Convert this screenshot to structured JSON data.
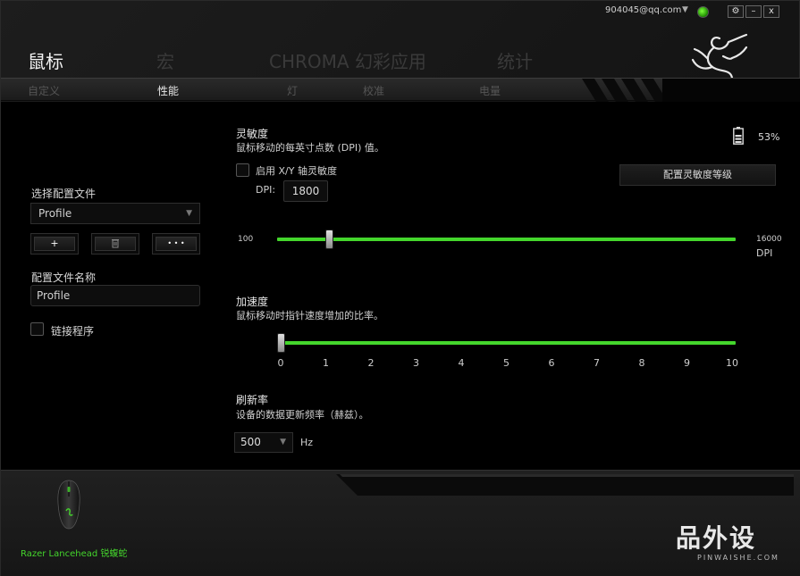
{
  "titlebar": {
    "account": "904045@qq.com",
    "gear_label": "⚙",
    "minimize_label": "–",
    "close_label": "x"
  },
  "main_tabs": [
    "鼠标",
    "宏",
    "CHROMA 幻彩应用",
    "统计"
  ],
  "sub_tabs": [
    "自定义",
    "性能",
    "灯",
    "校准",
    "电量"
  ],
  "left": {
    "select_profile_label": "选择配置文件",
    "profile_selected": "Profile",
    "add_label": "+",
    "delete_label": " ",
    "more_label": "• • •",
    "profile_name_label": "配置文件名称",
    "profile_name_value": "Profile",
    "link_program_label": "链接程序"
  },
  "sensitivity": {
    "title": "灵敏度",
    "description": "鼠标移动的每英寸点数 (DPI) 值。",
    "enable_xy_label": "启用 X/Y 轴灵敏度",
    "dpi_label": "DPI:",
    "dpi_value": "1800",
    "min_label": "100",
    "max_label": "16000",
    "unit_label": "DPI",
    "min": 100,
    "max": 16000,
    "value": 1800,
    "configure_button": "配置灵敏度等级"
  },
  "battery": {
    "percent": "53%"
  },
  "acceleration": {
    "title": "加速度",
    "description": "鼠标移动时指针速度增加的比率。",
    "ticks": [
      "0",
      "1",
      "2",
      "3",
      "4",
      "5",
      "6",
      "7",
      "8",
      "9",
      "10"
    ],
    "value": 0
  },
  "polling": {
    "title": "刷新率",
    "description": "设备的数据更新频率（赫兹）。",
    "selected": "500",
    "unit": "Hz"
  },
  "device": {
    "name": "Razer Lancehead 锐蝮蛇"
  },
  "watermark": {
    "title": "品外设",
    "url": "PINWAISHE.COM"
  },
  "colors": {
    "accent": "#44d62c",
    "background": "#000000"
  }
}
